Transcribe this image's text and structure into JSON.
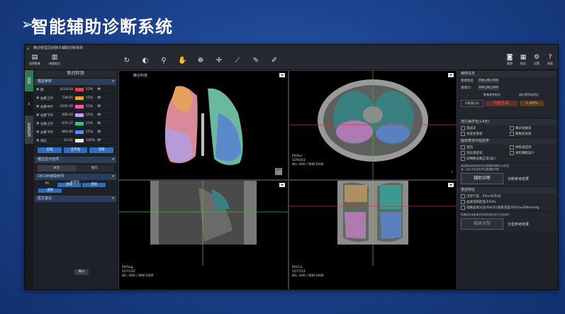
{
  "slide": {
    "arrow": "➢",
    "title": "智能辅助诊断系统"
  },
  "app": {
    "window_title": "精诊新型冠状肺炎辅助诊断系统",
    "toolbar_left": [
      {
        "label": "选择影像",
        "icon": "folder-icon"
      },
      {
        "label": "调阅报告",
        "icon": "report-icon"
      }
    ],
    "toolbar_right": [
      {
        "label": "截图",
        "icon": "camera-icon"
      },
      {
        "label": "报告",
        "icon": "report-icon"
      },
      {
        "label": "设置",
        "icon": "gear-icon"
      },
      {
        "label": "帮助",
        "icon": "help-icon"
      }
    ],
    "vertical_tabs": [
      "病例",
      "人",
      "影像检测"
    ],
    "left_panel": {
      "header": "新冠检测",
      "section_model_params": "模型参数",
      "rows": [
        {
          "name": "肺",
          "value": "4114.04",
          "pct": "15%",
          "color": "#e04444"
        },
        {
          "name": "右肺上叶",
          "value": "738.05",
          "pct": "15%",
          "color": "#f0a030"
        },
        {
          "name": "右肺中叶",
          "value": "1041.06",
          "pct": "15%",
          "color": "#f060b0"
        },
        {
          "name": "右肺下叶",
          "value": "490.20",
          "pct": "15%",
          "color": "#c0a0ff"
        },
        {
          "name": "左肺上叶",
          "value": "979.37",
          "pct": "15%",
          "color": "#40c090"
        },
        {
          "name": "左肺下叶",
          "value": "864.86",
          "pct": "15%",
          "color": "#5090f0"
        },
        {
          "name": "病灶",
          "value": "42.01",
          "pct": "100%",
          "color": "#e8e8e8"
        }
      ],
      "buttons": [
        "全选",
        "全不选",
        "渲染"
      ],
      "section_display": "模型显示选项",
      "toggle": [
        "体元",
        "线元"
      ],
      "dicom_select": "DICOM读取序列",
      "param_headers": [
        "",
        "标准化",
        "阈值化",
        "轮廓化"
      ],
      "param_rows": [
        {
          "label": "PS",
          "cells": [
            "连续",
            "连续",
            "连续"
          ]
        }
      ],
      "other_section": "医生建议",
      "ok_button": "确认"
    },
    "viewports": {
      "vp1": {
        "brand": "精诊科技",
        "reset": "复位"
      },
      "vp2": {
        "lines": [
          "P0/Axi",
          "129/263",
          "WL:-600 / WW:1600"
        ]
      },
      "vp3": {
        "lines": [
          "P0/Sag",
          "257/512",
          "WL:-600 / WW:1600"
        ]
      },
      "vp4": {
        "lines": [
          "P0/Cor",
          "257/512",
          "WL:-600 / WW:1600"
        ]
      }
    },
    "right_panel": {
      "case_info": "病例信息",
      "fields": [
        {
          "k": "患者姓名",
          "v": "liao_dz_nick"
        },
        {
          "k": "患者ID",
          "v": "liao_dz_nick"
        }
      ],
      "ai_label": "AI影像分析",
      "risk_labels": [
        "影像参考结论",
        "病灶累积体积比"
      ],
      "risk_values": [
        "可能性高",
        "1.04%"
      ],
      "epi_section": "流行病学史(14天)",
      "epi_items": [
        "旅居史",
        "确诊接触史",
        "有症状患者",
        "聚集性发病"
      ],
      "clin_section": "临床表现与检验学",
      "clin_items": [
        "发热",
        "呼吸道症状",
        "消化道症状",
        "淋巴细胞减少",
        "白细胞总数正常/减少"
      ],
      "note": "满足疑似病例标准或由核酸检测确认为阳性者，结合本系统参考结果辅助判断",
      "diag_button": "辅助诊断",
      "diag_result": "诊断参考结果",
      "severe_section": "重症特征",
      "severe_items": [
        "出现气促，RR≥30次/分",
        "血氧饱和度低于93%",
        "动脉血氧分压(PaO2)/吸氧浓度(FiO2)≤300mmHg"
      ],
      "class_note": "根据症状及影像学表现对病例进行分型参考",
      "class_button": "临床分型",
      "class_result": "分型参考结果"
    }
  }
}
